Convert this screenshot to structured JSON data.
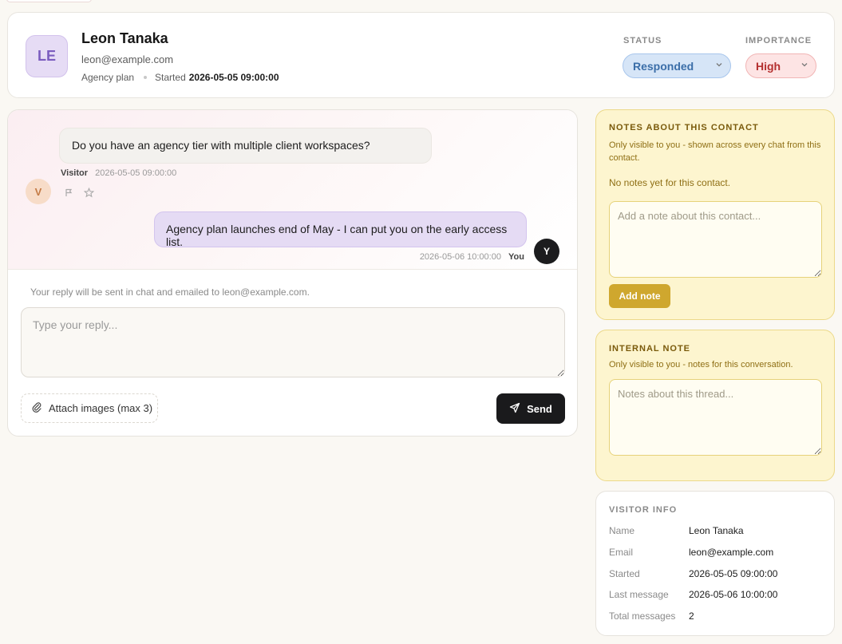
{
  "header": {
    "avatar_initials": "LE",
    "name": "Leon Tanaka",
    "email": "leon@example.com",
    "plan": "Agency plan",
    "started_label": "Started",
    "started_value": "2026-05-05 09:00:00",
    "status_label": "STATUS",
    "status_value": "Responded",
    "importance_label": "IMPORTANCE",
    "importance_value": "High"
  },
  "chat": {
    "messages": [
      {
        "sender": "Visitor",
        "avatar": "V",
        "text": "Do you have an agency tier with multiple client workspaces?",
        "time": "2026-05-05 09:00:00"
      },
      {
        "sender": "You",
        "avatar": "Y",
        "text": "Agency plan launches end of May - I can put you on the early access list.",
        "time": "2026-05-06 10:00:00"
      }
    ],
    "reply_hint": "Your reply will be sent in chat and emailed to leon@example.com.",
    "reply_placeholder": "Type your reply...",
    "attach_label": "Attach images (max 3)",
    "send_label": "Send"
  },
  "contact_notes": {
    "title": "NOTES ABOUT THIS CONTACT",
    "subtitle": "Only visible to you - shown across every chat from this contact.",
    "empty_text": "No notes yet for this contact.",
    "placeholder": "Add a note about this contact...",
    "add_label": "Add note"
  },
  "internal_note": {
    "title": "INTERNAL NOTE",
    "subtitle": "Only visible to you - notes for this conversation.",
    "placeholder": "Notes about this thread..."
  },
  "visitor_info": {
    "title": "VISITOR INFO",
    "rows": [
      {
        "key": "Name",
        "value": "Leon Tanaka"
      },
      {
        "key": "Email",
        "value": "leon@example.com"
      },
      {
        "key": "Started",
        "value": "2026-05-05 09:00:00"
      },
      {
        "key": "Last message",
        "value": "2026-05-06 10:00:00"
      },
      {
        "key": "Total messages",
        "value": "2"
      }
    ]
  },
  "colors": {
    "status_bg": "#d6e5f7",
    "importance_bg": "#fde4e4",
    "note_bg": "#fdf5cf",
    "send_bg": "#1a1a1c"
  },
  "icons": {
    "chevron": "chevron-down-icon",
    "flag": "flag-icon",
    "star": "star-icon",
    "paperclip": "paperclip-icon",
    "send": "send-icon"
  }
}
